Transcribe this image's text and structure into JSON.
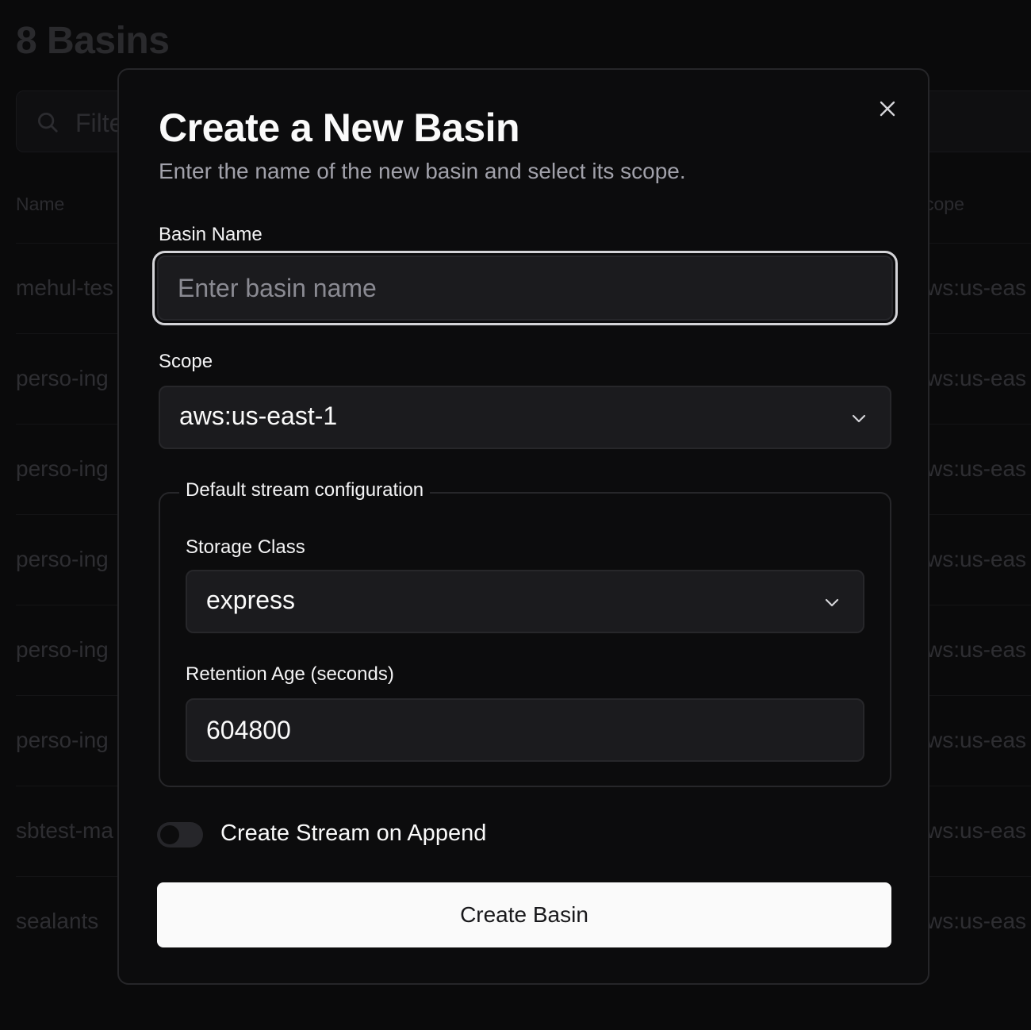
{
  "background": {
    "title": "8 Basins",
    "filter_placeholder": "Filte",
    "columns": {
      "name": "Name",
      "scope": "cope"
    },
    "rows": [
      {
        "name": "mehul-tes",
        "scope": "ws:us-eas"
      },
      {
        "name": "perso-ing",
        "scope": "ws:us-eas"
      },
      {
        "name": "perso-ing",
        "scope": "ws:us-eas"
      },
      {
        "name": "perso-ing",
        "scope": "ws:us-eas"
      },
      {
        "name": "perso-ing",
        "scope": "ws:us-eas"
      },
      {
        "name": "perso-ing",
        "scope": "ws:us-eas"
      },
      {
        "name": "sbtest-ma",
        "scope": "ws:us-eas"
      },
      {
        "name": "sealants",
        "scope": "ws:us-eas"
      }
    ]
  },
  "modal": {
    "title": "Create a New Basin",
    "subtitle": "Enter the name of the new basin and select its scope.",
    "basin_name": {
      "label": "Basin Name",
      "placeholder": "Enter basin name",
      "value": ""
    },
    "scope": {
      "label": "Scope",
      "value": "aws:us-east-1"
    },
    "stream_config": {
      "legend": "Default stream configuration",
      "storage_class": {
        "label": "Storage Class",
        "value": "express"
      },
      "retention_age": {
        "label": "Retention Age (seconds)",
        "value": "604800"
      }
    },
    "create_stream_on_append": {
      "label": "Create Stream on Append",
      "enabled": false
    },
    "submit_label": "Create Basin"
  },
  "icons": {
    "close": "close-icon",
    "chevron": "chevron-down-icon",
    "search": "search-icon"
  },
  "colors": {
    "modal_bg": "#0c0c0d",
    "input_bg": "#1b1b1e",
    "primary_button": "#fafafa",
    "focus_ring": "#d4d4d8"
  }
}
